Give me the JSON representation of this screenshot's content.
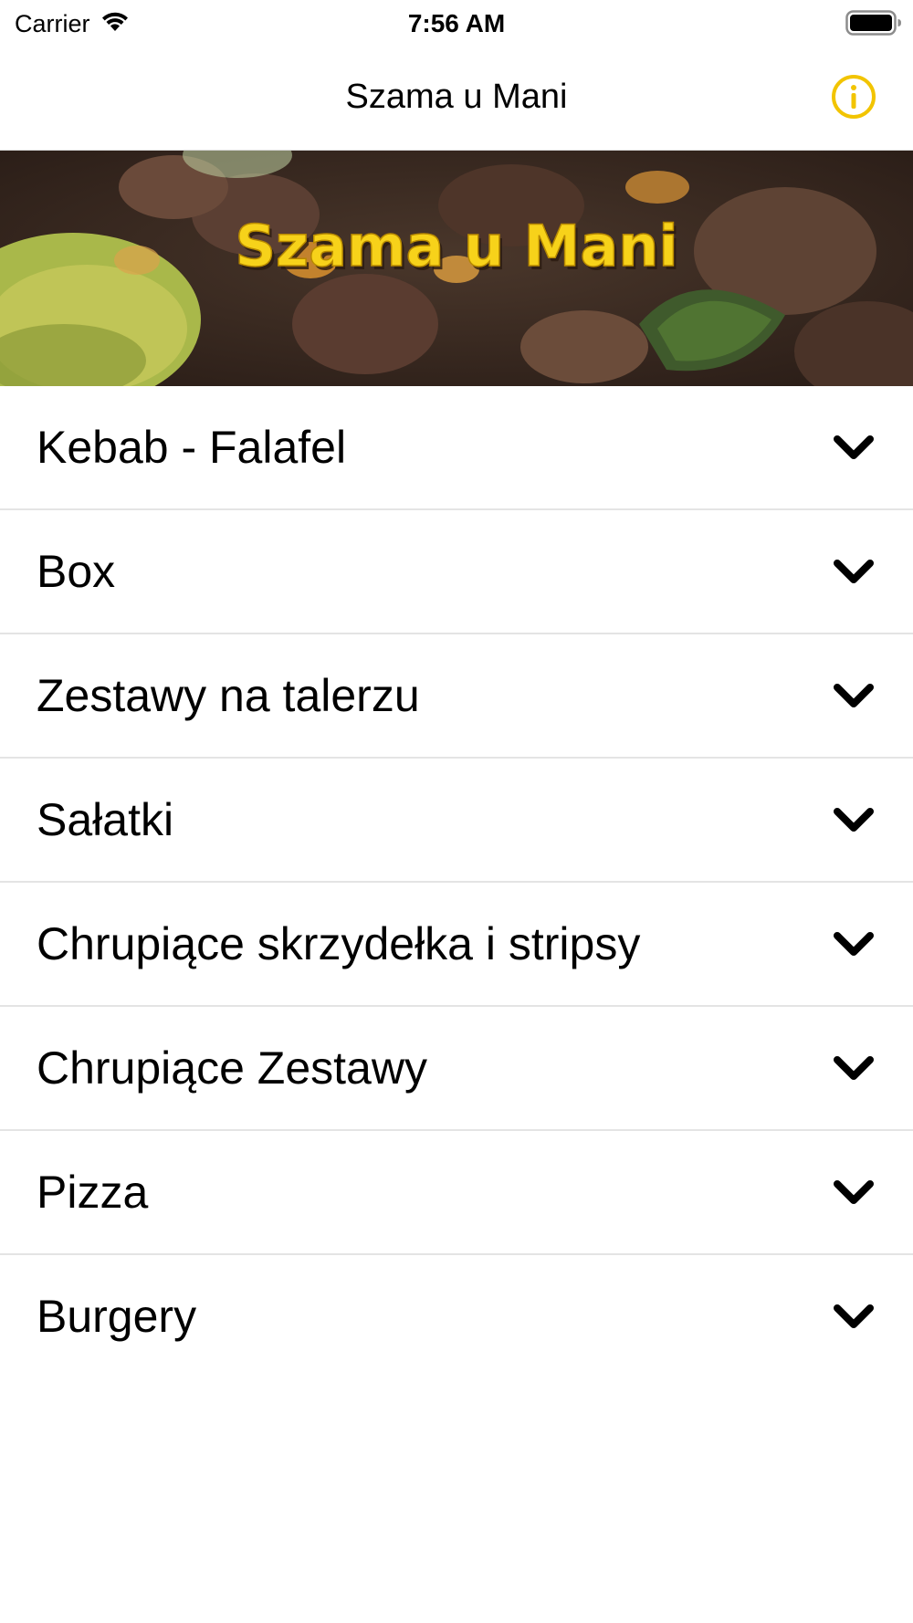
{
  "status_bar": {
    "carrier": "Carrier",
    "time": "7:56 AM",
    "wifi_icon": "wifi-icon",
    "battery_icon": "battery-full-icon"
  },
  "nav_bar": {
    "title": "Szama u Mani",
    "info_icon": "info-circle-icon",
    "accent_color": "#F2C400"
  },
  "banner": {
    "logo_text": "Szama u Mani",
    "logo_color": "#F7D21A"
  },
  "menu": {
    "items": [
      {
        "label": "Kebab - Falafel",
        "icon": "chevron-down-icon"
      },
      {
        "label": "Box",
        "icon": "chevron-down-icon"
      },
      {
        "label": "Zestawy na talerzu",
        "icon": "chevron-down-icon"
      },
      {
        "label": "Sałatki",
        "icon": "chevron-down-icon"
      },
      {
        "label": "Chrupiące skrzydełka i stripsy",
        "icon": "chevron-down-icon"
      },
      {
        "label": "Chrupiące Zestawy",
        "icon": "chevron-down-icon"
      },
      {
        "label": "Pizza",
        "icon": "chevron-down-icon"
      },
      {
        "label": "Burgery",
        "icon": "chevron-down-icon"
      }
    ]
  }
}
